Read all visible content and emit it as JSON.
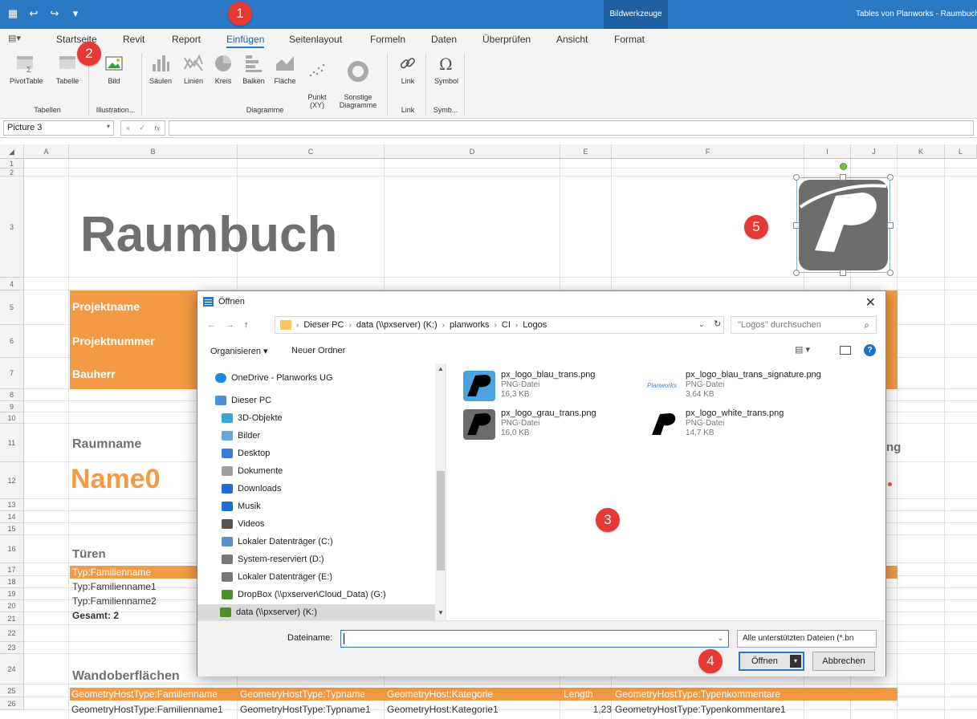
{
  "window": {
    "context_tab": "Bildwerkzeuge",
    "title": "Tables von Planworks - Raumbuch"
  },
  "qat": {
    "app_icon": "grid-icon",
    "undo_icon": "undo-icon",
    "redo_icon": "redo-icon",
    "more_icon": "chevron-down-icon"
  },
  "tabs": [
    "Startseite",
    "Revit",
    "Report",
    "Einfügen",
    "Seitenlayout",
    "Formeln",
    "Daten",
    "Überprüfen",
    "Ansicht",
    "Format"
  ],
  "active_tab": "Einfügen",
  "ribbon": {
    "buttons": {
      "pivot": "PivotTable",
      "tabelle": "Tabelle",
      "bild": "Bild",
      "saeulen": "Säulen",
      "linien": "Linien",
      "kreis": "Kreis",
      "balken": "Balken",
      "flaeche": "Fläche",
      "punkt": "Punkt\n(XY)",
      "sonstige": "Sonstige\nDiagramme",
      "link": "Link",
      "symbol": "Symbol"
    },
    "groups": {
      "tabellen": "Tabellen",
      "illustrationen": "Illustration...",
      "diagramme": "Diagramme",
      "link": "Link",
      "symbole": "Symb..."
    }
  },
  "formula_bar": {
    "name_box": "Picture 3",
    "cancel": "×",
    "enter": "✓",
    "fx": "fx",
    "value": ""
  },
  "columns": [
    "A",
    "B",
    "C",
    "D",
    "E",
    "F",
    "I",
    "J",
    "K",
    "L"
  ],
  "rows": [
    "1",
    "2",
    "3",
    "4",
    "5",
    "6",
    "7",
    "8",
    "9",
    "10",
    "11",
    "12",
    "13",
    "14",
    "15",
    "16",
    "17",
    "18",
    "19",
    "20",
    "21",
    "22",
    "23",
    "24",
    "25",
    "26"
  ],
  "sheet": {
    "title": "Raumbuch",
    "projektname": "Projektname",
    "projektnummer": "Projektnummer",
    "bauherr": "Bauherr",
    "raumname_label": "Raumname",
    "raumname_value": "Name0",
    "right_fragment": "ng",
    "tueren": "Türen",
    "tueren_header": "Typ:Familienname",
    "tueren_rows": [
      "Typ:Familienname1",
      "Typ:Familienname2"
    ],
    "gesamt": "Gesamt: 2",
    "wand": "Wandoberflächen",
    "wand_headers": [
      "GeometryHostType:Familienname",
      "GeometryHostType:Typname",
      "GeometryHost:Kategorie",
      "Length",
      "GeometryHostType:Typenkommentare"
    ],
    "wand_row": [
      "GeometryHostType:Familienname1",
      "GeometryHostType:Typname1",
      "GeometryHost:Kategorie1",
      "1,23",
      "GeometryHostType:Typenkommentare1"
    ]
  },
  "dialog": {
    "title": "Öffnen",
    "path": [
      "Dieser PC",
      "data (\\\\pxserver) (K:)",
      "planworks",
      "CI",
      "Logos"
    ],
    "search_placeholder": "\"Logos\" durchsuchen",
    "organize": "Organisieren ▾",
    "new_folder": "Neuer Ordner",
    "nav_items": [
      "OneDrive - Planworks UG",
      "Dieser PC",
      "3D-Objekte",
      "Bilder",
      "Desktop",
      "Dokumente",
      "Downloads",
      "Musik",
      "Videos",
      "Lokaler Datenträger (C:)",
      "System-reserviert (D:)",
      "Lokaler Datenträger (E:)",
      "DropBox (\\\\pxserver\\Cloud_Data) (G:)",
      "data (\\\\pxserver) (K:)"
    ],
    "files": [
      {
        "name": "px_logo_blau_trans.png",
        "type": "PNG-Datei",
        "size": "16,3 KB",
        "bg": "#4aa3df"
      },
      {
        "name": "px_logo_blau_trans_signature.png",
        "type": "PNG-Datei",
        "size": "3,64 KB",
        "bg": "#ffffff"
      },
      {
        "name": "px_logo_grau_trans.png",
        "type": "PNG-Datei",
        "size": "16,0 KB",
        "bg": "#6b6b6b"
      },
      {
        "name": "px_logo_white_trans.png",
        "type": "PNG-Datei",
        "size": "14,7 KB",
        "bg": "#ffffff"
      }
    ],
    "signature_text": "Planworks",
    "filename_label": "Dateiname:",
    "filename_value": "",
    "filetype": "Alle unterstützten Dateien (*.bn",
    "open_button": "Öffnen",
    "cancel_button": "Abbrechen"
  },
  "callouts": [
    "1",
    "2",
    "3",
    "4",
    "5"
  ],
  "colors": {
    "accent": "#2b78c5",
    "orange": "#f39a44",
    "title_grey": "#707070",
    "callout_red": "#e53935"
  }
}
